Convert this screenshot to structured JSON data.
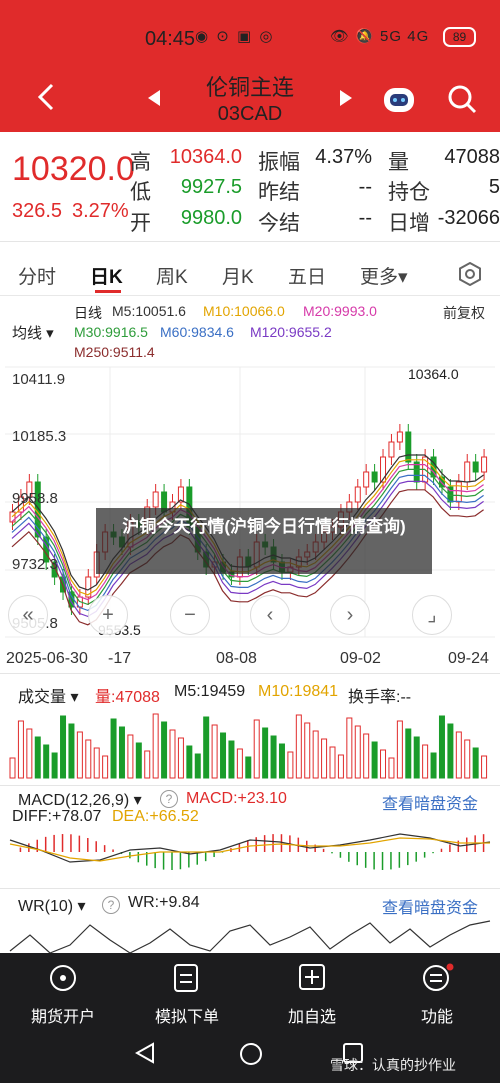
{
  "status_bar": {
    "time": "04:45",
    "icons_left": "◉ ⊙ ▣ ◎",
    "icons_right": "👁 🔕 5G 4G",
    "battery": "89"
  },
  "header": {
    "title": "伦铜主连",
    "subtitle": "03CAD",
    "back": "<",
    "prev": "◀",
    "next": "▶"
  },
  "quote": {
    "price": "10320.0",
    "change": "326.5",
    "change_pct": "3.27%",
    "rows": [
      {
        "l1": "高",
        "v1": "10364.0",
        "c1": "red",
        "l2": "振幅",
        "v2": "4.37%",
        "l3": "量",
        "v3": "47088"
      },
      {
        "l1": "低",
        "v1": "9927.5",
        "c1": "green",
        "l2": "昨结",
        "v2": "--",
        "l3": "持仓",
        "v3": "5"
      },
      {
        "l1": "开",
        "v1": "9980.0",
        "c1": "green",
        "l2": "今结",
        "v2": "--",
        "l3": "日增",
        "v3": "-32066"
      }
    ]
  },
  "tabs": {
    "t0": "分时",
    "t1": "日K",
    "t2": "周K",
    "t3": "月K",
    "t4": "五日",
    "t5": "更多▾"
  },
  "main_chart": {
    "period": "日线",
    "ma_select": "均线 ▾",
    "adjust": "前复权",
    "m5": "M5:10051.6",
    "m10": "M10:10066.0",
    "m20": "M20:9993.0",
    "m30": "M30:9916.5",
    "m60": "M60:9834.6",
    "m120": "M120:9655.2",
    "m250": "M250:9511.4",
    "y_top": "10411.9",
    "y_mid": "10185.3",
    "y_3": "9958.8",
    "y_4": "9732.3",
    "y_5": "9505.8",
    "high_mark": "10364.0",
    "low_mark": "9553.5",
    "dates": [
      "2025-06-30",
      "-17",
      "08-08",
      "09-02",
      "09-24"
    ],
    "colors": {
      "m5": "#333333",
      "m10": "#e2a400",
      "m20": "#d63aa9",
      "m30": "#2e9c3a",
      "m60": "#3a6fc4",
      "m120": "#7a3ac4",
      "m250": "#8b2d2d"
    }
  },
  "overlay": {
    "text": "沪铜今天行情(沪铜今日行情行情查询)"
  },
  "volume": {
    "label": "成交量 ▾",
    "vol": "量:47088",
    "m5": "M5:19459",
    "m10": "M10:19841",
    "turnover": "换手率:--"
  },
  "macd": {
    "label": "MACD(12,26,9) ▾",
    "macd": "MACD:+23.10",
    "diff": "DIFF:+78.07",
    "dea": "DEA:+66.52",
    "link": "查看暗盘资金"
  },
  "wr": {
    "label": "WR(10) ▾",
    "wr": "WR:+9.84",
    "link": "查看暗盘资金"
  },
  "bottom_nav": {
    "b0": "期货开户",
    "b1": "模拟下单",
    "b2": "加自选",
    "b3": "功能"
  },
  "watermark": "雪球：认真的抄作业"
}
